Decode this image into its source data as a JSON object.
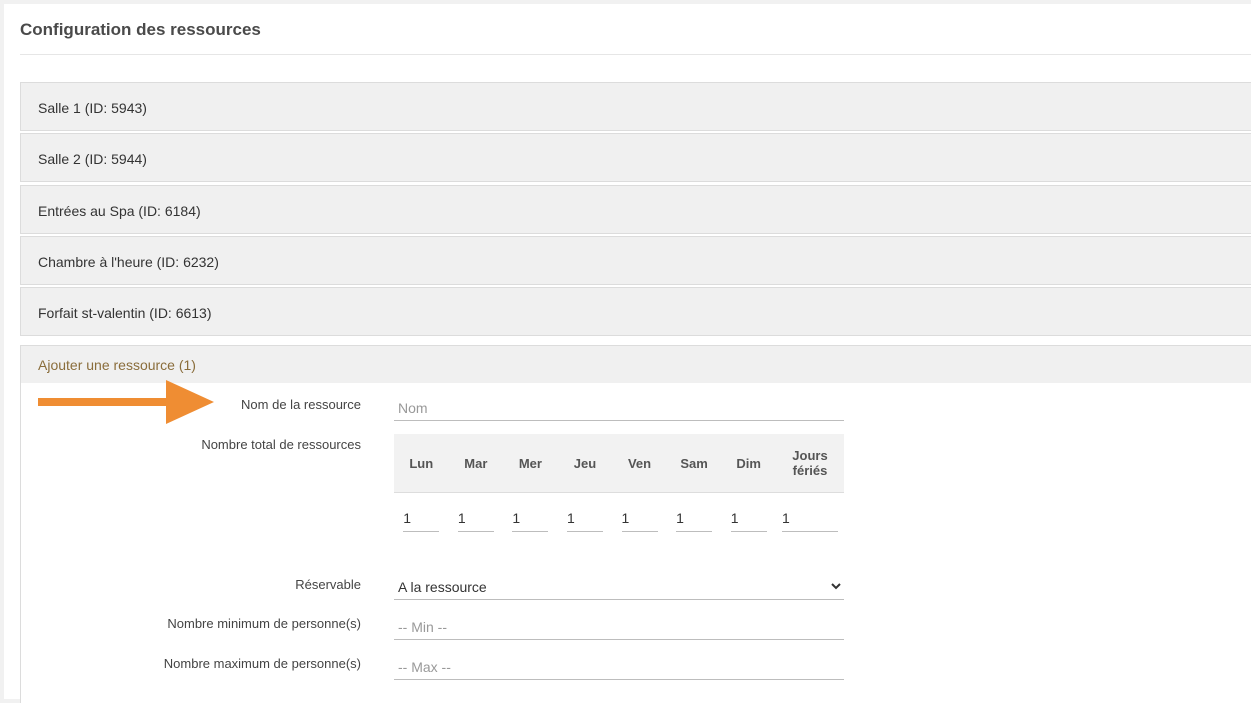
{
  "page": {
    "title": "Configuration des ressources"
  },
  "resources": [
    {
      "label": "Salle 1 (ID: 5943)"
    },
    {
      "label": "Salle 2 (ID: 5944)"
    },
    {
      "label": "Entrées au Spa (ID: 6184)"
    },
    {
      "label": "Chambre à l'heure (ID: 6232)"
    },
    {
      "label": "Forfait st-valentin (ID: 6613)"
    }
  ],
  "add_resource": {
    "header": "Ajouter une ressource (1)",
    "name_label": "Nom de la ressource",
    "name_placeholder": "Nom",
    "total_label": "Nombre total de ressources",
    "days": [
      "Lun",
      "Mar",
      "Mer",
      "Jeu",
      "Ven",
      "Sam",
      "Dim"
    ],
    "holidays_line1": "Jours",
    "holidays_line2": "fériés",
    "day_values": [
      "1",
      "1",
      "1",
      "1",
      "1",
      "1",
      "1",
      "1"
    ],
    "reservable_label": "Réservable",
    "reservable_value": "A la ressource",
    "min_label": "Nombre minimum de personne(s)",
    "min_placeholder": "-- Min --",
    "max_label": "Nombre maximum de personne(s)",
    "max_placeholder": "-- Max --"
  },
  "colors": {
    "arrow": "#ef8d33",
    "add_header_text": "#8a6d3b"
  },
  "icons": {
    "arrow": "arrow-right-icon",
    "select": "chevron-down-icon"
  }
}
